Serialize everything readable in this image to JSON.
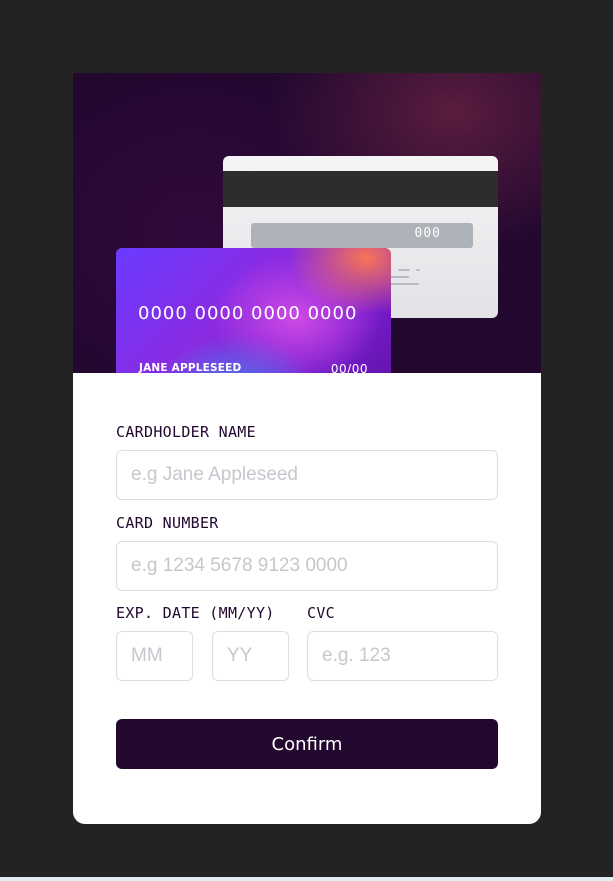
{
  "card": {
    "front": {
      "number": "0000 0000 0000 0000",
      "holder": "JANE APPLESEED",
      "expiry": "00/00"
    },
    "back": {
      "cvc": "000"
    }
  },
  "form": {
    "cardholder_name": {
      "label": "CARDHOLDER NAME",
      "placeholder": "e.g Jane Appleseed",
      "value": ""
    },
    "card_number": {
      "label": "CARD NUMBER",
      "placeholder": "e.g 1234 5678 9123 0000",
      "value": ""
    },
    "exp_date": {
      "label": "EXP. DATE (MM/YY)",
      "month_placeholder": "MM",
      "year_placeholder": "YY"
    },
    "cvc": {
      "label": "CVC",
      "placeholder": "e.g. 123"
    },
    "confirm_label": "Confirm"
  },
  "colors": {
    "page_background": "#232323",
    "hero_background": "#22082f",
    "button_background": "#22082f",
    "panel_background": "#ffffff"
  }
}
